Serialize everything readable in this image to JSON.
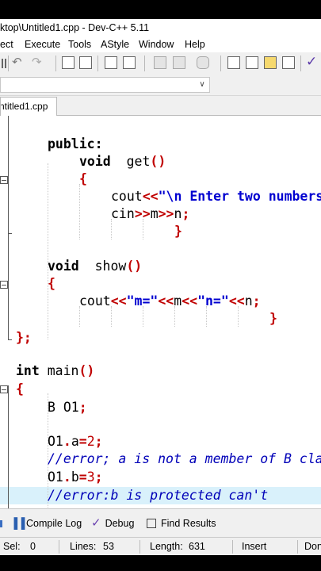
{
  "window": {
    "title": "ktop\\Untitled1.cpp - Dev-C++ 5.11"
  },
  "menu": [
    "ect",
    "Execute",
    "Tools",
    "AStyle",
    "Window",
    "Help"
  ],
  "tab": {
    "label": "ntitled1.cpp"
  },
  "code": [
    {
      "id": "public",
      "parts": [
        [
          "kw",
          "public:"
        ]
      ]
    },
    {
      "id": "void-get",
      "parts": [
        [
          "kw",
          "void"
        ],
        [
          "",
          "  get"
        ],
        [
          "sym",
          "()"
        ]
      ]
    },
    {
      "id": "brace-open-1",
      "parts": [
        [
          "sym",
          "{"
        ]
      ]
    },
    {
      "id": "cout-1",
      "parts": [
        [
          "",
          "cout"
        ],
        [
          "sym",
          "<<"
        ],
        [
          "str",
          "\"\\n Enter two numbers"
        ]
      ]
    },
    {
      "id": "cin",
      "parts": [
        [
          "",
          "cin"
        ],
        [
          "sym",
          ">>"
        ],
        [
          "",
          "m"
        ],
        [
          "sym",
          ">>"
        ],
        [
          "",
          "n"
        ],
        [
          "sym",
          ";"
        ]
      ]
    },
    {
      "id": "brace-close-1",
      "parts": [
        [
          "sym",
          "}"
        ]
      ]
    },
    {
      "id": "void-show",
      "parts": [
        [
          "kw",
          "void"
        ],
        [
          "",
          "  show"
        ],
        [
          "sym",
          "()"
        ]
      ]
    },
    {
      "id": "brace-open-2",
      "parts": [
        [
          "sym",
          "{"
        ]
      ]
    },
    {
      "id": "cout-2",
      "parts": [
        [
          "",
          "cout"
        ],
        [
          "sym",
          "<<"
        ],
        [
          "str",
          "\"m=\""
        ],
        [
          "sym",
          "<<"
        ],
        [
          "",
          "m"
        ],
        [
          "sym",
          "<<"
        ],
        [
          "str",
          "\"n=\""
        ],
        [
          "sym",
          "<<"
        ],
        [
          "",
          "n"
        ],
        [
          "sym",
          ";"
        ]
      ]
    },
    {
      "id": "brace-close-2",
      "parts": [
        [
          "sym",
          "}"
        ]
      ]
    },
    {
      "id": "class-end",
      "parts": [
        [
          "sym",
          "};"
        ]
      ]
    },
    {
      "id": "int-main",
      "parts": [
        [
          "kw",
          "int"
        ],
        [
          "",
          " main"
        ],
        [
          "sym",
          "()"
        ]
      ]
    },
    {
      "id": "brace-open-3",
      "parts": [
        [
          "sym",
          "{"
        ]
      ]
    },
    {
      "id": "decl",
      "parts": [
        [
          "",
          "B O1"
        ],
        [
          "sym",
          ";"
        ]
      ]
    },
    {
      "id": "assign-a",
      "parts": [
        [
          "",
          "O1"
        ],
        [
          "sym",
          "."
        ],
        [
          "",
          "a"
        ],
        [
          "sym",
          "="
        ],
        [
          "num",
          "2"
        ],
        [
          "sym",
          ";"
        ]
      ]
    },
    {
      "id": "comment-a",
      "parts": [
        [
          "cm",
          "//error; a is not a member of B class"
        ]
      ]
    },
    {
      "id": "assign-b",
      "parts": [
        [
          "",
          "O1"
        ],
        [
          "sym",
          "."
        ],
        [
          "",
          "b"
        ],
        [
          "sym",
          "="
        ],
        [
          "num",
          "3"
        ],
        [
          "sym",
          ";"
        ]
      ]
    },
    {
      "id": "comment-b",
      "parts": [
        [
          "cm",
          "//error:b is protected can't"
        ]
      ]
    }
  ],
  "bottom_tabs": [
    {
      "label": "Compile Log",
      "icon": "compile-log-icon"
    },
    {
      "label": "Debug",
      "icon": "debug-check-icon"
    },
    {
      "label": "Find Results",
      "icon": "find-results-icon"
    }
  ],
  "status": {
    "sel_label": "Sel:",
    "sel_value": "0",
    "lines_label": "Lines:",
    "lines_value": "53",
    "length_label": "Length:",
    "length_value": "631",
    "mode": "Insert",
    "done": "Don"
  },
  "colors": {
    "keyword": "#000000",
    "symbol": "#c00000",
    "string": "#0000d0",
    "comment": "#0000b8",
    "current_line": "#d9f1fb"
  }
}
